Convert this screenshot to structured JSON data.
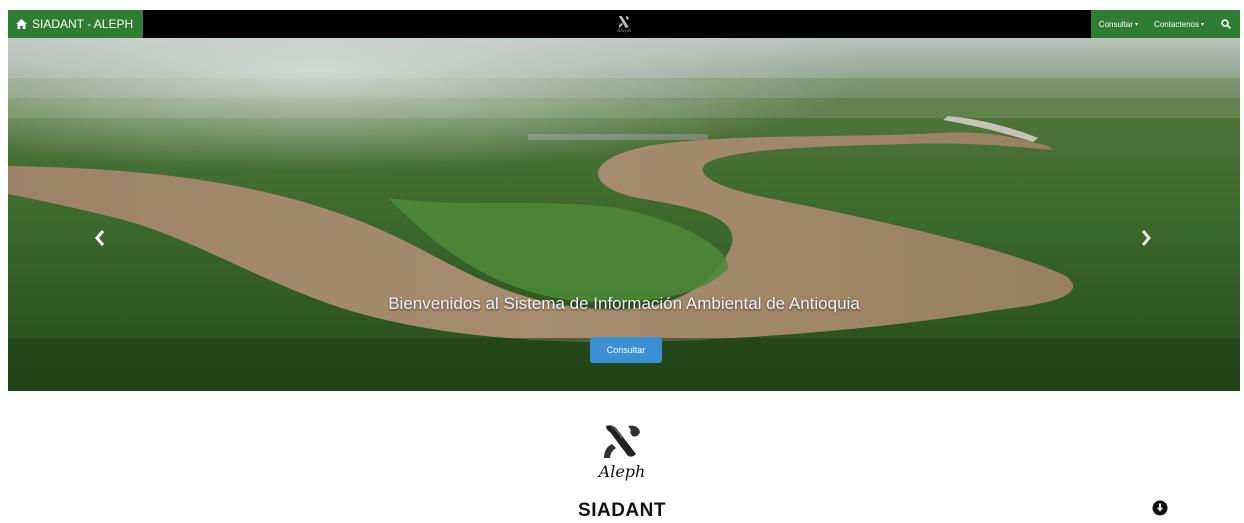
{
  "navbar": {
    "brand_label": "SIADANT - ALEPH",
    "center_logo_text": "Aleph",
    "menu": [
      {
        "label": "Consultar"
      },
      {
        "label": "Contactenos"
      }
    ]
  },
  "hero": {
    "title": "Bienvenidos al Sistema de Información Ambiental de Antioquia",
    "button_label": "Consultar"
  },
  "footer_logo": {
    "word": "Aleph",
    "site_name": "SIADANT"
  },
  "colors": {
    "brand_green": "#2e7d32",
    "navbar_black": "#000000",
    "button_blue": "#3b8fd4"
  },
  "icons": [
    "home-icon",
    "aleph-icon",
    "caret-down-icon",
    "search-icon",
    "chevron-left-icon",
    "chevron-right-icon",
    "arrow-down-circle-icon"
  ]
}
